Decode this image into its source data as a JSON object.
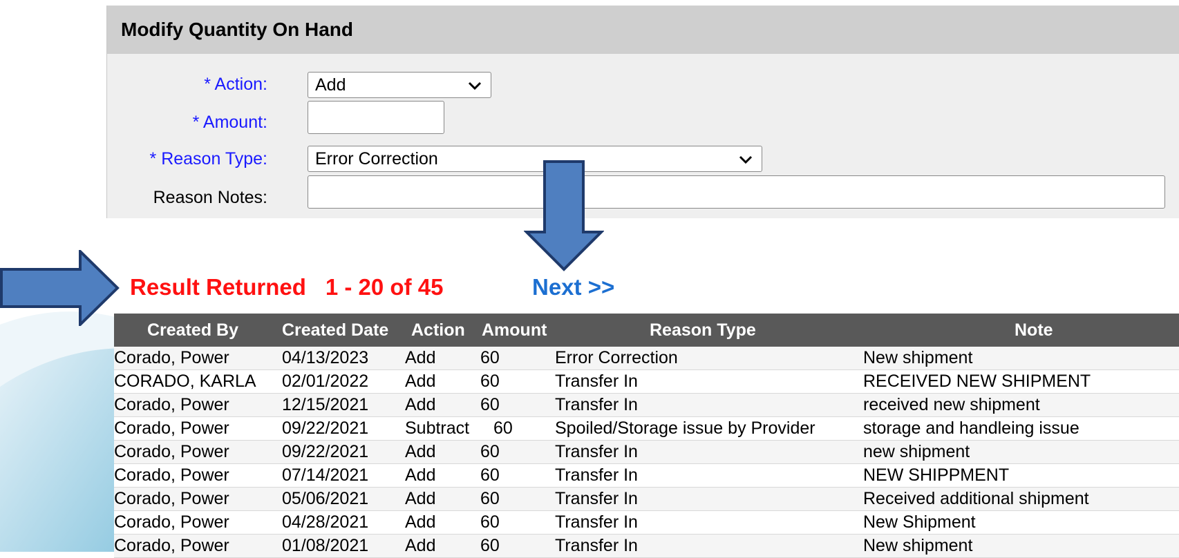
{
  "panel": {
    "title": "Modify Quantity On Hand",
    "action_label": "* Action:",
    "action_value": "Add",
    "amount_label": "* Amount:",
    "amount_value": "",
    "reason_type_label": "* Reason Type:",
    "reason_type_value": "Error Correction",
    "reason_notes_label": "Reason Notes:",
    "reason_notes_value": ""
  },
  "results": {
    "label": "Result Returned",
    "range": "1 - 20 of 45",
    "next_label": "Next >>"
  },
  "table": {
    "headers": [
      "Created By",
      "Created Date",
      "Action",
      "Amount",
      "Reason Type",
      "Note"
    ],
    "rows": [
      [
        "Corado, Power",
        "04/13/2023",
        "Add",
        "60",
        "Error Correction",
        "New shipment"
      ],
      [
        "CORADO, KARLA",
        "02/01/2022",
        "Add",
        "60",
        "Transfer In",
        "RECEIVED NEW SHIPMENT"
      ],
      [
        "Corado, Power",
        "12/15/2021",
        "Add",
        "60",
        "Transfer In",
        "received new shipment"
      ],
      [
        "Corado, Power",
        "09/22/2021",
        "Subtract",
        "60",
        "Spoiled/Storage issue by Provider",
        "storage and handleing issue"
      ],
      [
        "Corado, Power",
        "09/22/2021",
        "Add",
        "60",
        "Transfer In",
        "new shipment"
      ],
      [
        "Corado, Power",
        "07/14/2021",
        "Add",
        "60",
        "Transfer In",
        "NEW SHIPPMENT"
      ],
      [
        "Corado, Power",
        "05/06/2021",
        "Add",
        "60",
        "Transfer In",
        "Received additional shipment"
      ],
      [
        "Corado, Power",
        "04/28/2021",
        "Add",
        "60",
        "Transfer In",
        "New Shipment"
      ],
      [
        "Corado, Power",
        "01/08/2021",
        "Add",
        "60",
        "Transfer In",
        "New shipment"
      ]
    ]
  },
  "colors": {
    "label_blue": "#1a1aff",
    "result_red": "#ff1111",
    "next_blue": "#1c6fd1",
    "arrow_fill": "#4f7fc0",
    "arrow_stroke": "#1f3a6b",
    "header_bg": "#595959"
  }
}
